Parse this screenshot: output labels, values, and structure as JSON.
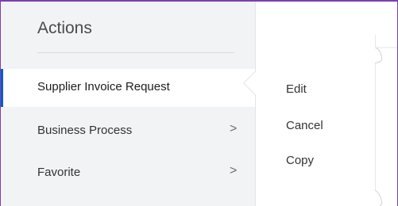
{
  "actions_panel": {
    "title": "Actions",
    "items": [
      {
        "label": "Supplier Invoice Request",
        "selected": true,
        "has_submenu": false
      },
      {
        "label": "Business Process",
        "selected": false,
        "has_submenu": true
      },
      {
        "label": "Favorite",
        "selected": false,
        "has_submenu": true
      }
    ]
  },
  "submenu": {
    "items": [
      {
        "label": "Edit"
      },
      {
        "label": "Cancel"
      },
      {
        "label": "Copy"
      }
    ]
  },
  "colors": {
    "frame_border": "#7b3fb1",
    "selected_accent": "#0b5cc9",
    "panel_background": "#f2f3f4"
  },
  "icons": {
    "chevron": "chevron-right-icon"
  }
}
